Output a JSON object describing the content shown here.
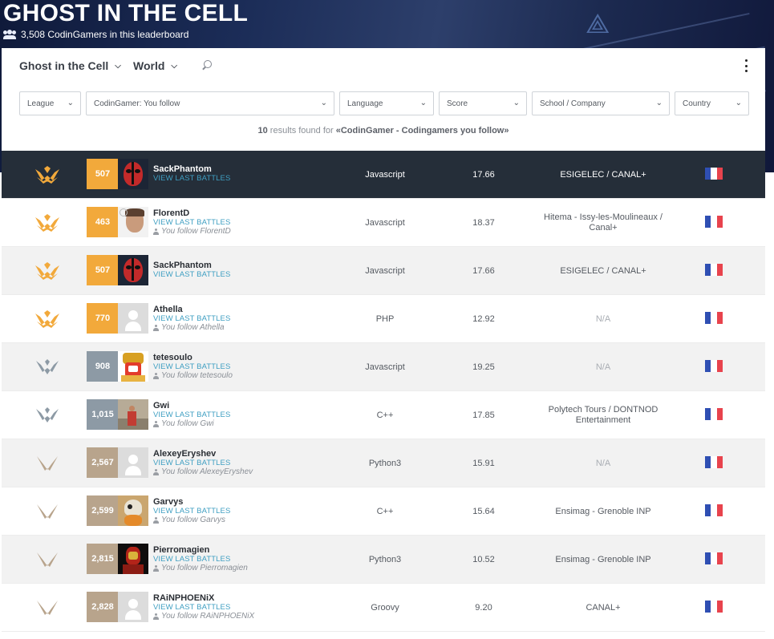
{
  "header": {
    "title": "GHOST IN THE CELL",
    "count_text": "3,508 CodinGamers in this leaderboard"
  },
  "topbar": {
    "game_label": "Ghost in the Cell",
    "scope_label": "World"
  },
  "filters": {
    "league": "League",
    "codingamer": "CodinGamer: You follow",
    "language": "Language",
    "score": "Score",
    "school": "School / Company",
    "country": "Country"
  },
  "results": {
    "count": "10",
    "middle": " results found for ",
    "query": "«CodinGamer - Codingamers you follow»"
  },
  "colors": {
    "gold": "#f2a93b",
    "silver": "#8d9aa5",
    "bronze": "#b8a48c",
    "me_row": "#252e39",
    "link": "#3f9fc2"
  },
  "view_battles_label": "VIEW LAST BATTLES",
  "rows": [
    {
      "rank": "507",
      "name": "SackPhantom",
      "follow": "",
      "language": "Javascript",
      "score": "17.66",
      "school": "ESIGELEC / CANAL+",
      "league": "gold",
      "avatar": "deadpool",
      "me": true
    },
    {
      "rank": "463",
      "name": "FlorentD",
      "follow": "You follow FlorentD",
      "language": "Javascript",
      "score": "18.37",
      "school": "Hitema - Issy-les-Moulineaux / Canal+",
      "league": "gold",
      "avatar": "photo-face"
    },
    {
      "rank": "507",
      "name": "SackPhantom",
      "follow": "",
      "language": "Javascript",
      "score": "17.66",
      "school": "ESIGELEC / CANAL+",
      "league": "gold",
      "avatar": "deadpool"
    },
    {
      "rank": "770",
      "name": "Athella",
      "follow": "You follow Athella",
      "language": "PHP",
      "score": "12.92",
      "school": "N/A",
      "league": "gold",
      "avatar": "placeholder"
    },
    {
      "rank": "908",
      "name": "tetesoulo",
      "follow": "You follow tetesoulo",
      "language": "Javascript",
      "score": "19.25",
      "school": "N/A",
      "league": "silver",
      "avatar": "cartoon"
    },
    {
      "rank": "1,015",
      "name": "Gwi",
      "follow": "You follow Gwi",
      "language": "C++",
      "score": "17.85",
      "school": "Polytech Tours / DONTNOD Entertainment",
      "league": "silver",
      "avatar": "photo-figure"
    },
    {
      "rank": "2,567",
      "name": "AlexeyEryshev",
      "follow": "You follow AlexeyEryshev",
      "language": "Python3",
      "score": "15.91",
      "school": "N/A",
      "league": "bronze",
      "avatar": "placeholder"
    },
    {
      "rank": "2,599",
      "name": "Garvys",
      "follow": "You follow Garvys",
      "language": "C++",
      "score": "15.64",
      "school": "Ensimag - Grenoble INP",
      "league": "bronze",
      "avatar": "robot"
    },
    {
      "rank": "2,815",
      "name": "Pierromagien",
      "follow": "You follow Pierromagien",
      "language": "Python3",
      "score": "10.52",
      "school": "Ensimag - Grenoble INP",
      "league": "bronze",
      "avatar": "ironman"
    },
    {
      "rank": "2,828",
      "name": "RAiNPHOENiX",
      "follow": "You follow RAiNPHOENiX",
      "language": "Groovy",
      "score": "9.20",
      "school": "CANAL+",
      "league": "bronze",
      "avatar": "placeholder"
    }
  ]
}
